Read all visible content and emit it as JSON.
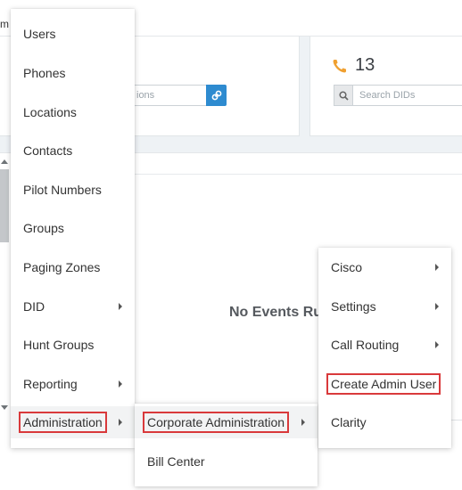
{
  "background": {
    "top_fragment": "m",
    "contacts_search_placeholder": "ions",
    "did_count": "13",
    "did_search_placeholder": "Search DIDs",
    "events_empty_text": "No Events Ru"
  },
  "main_menu": {
    "items": [
      {
        "label": "Users",
        "has_submenu": false
      },
      {
        "label": "Phones",
        "has_submenu": false
      },
      {
        "label": "Locations",
        "has_submenu": false
      },
      {
        "label": "Contacts",
        "has_submenu": false
      },
      {
        "label": "Pilot Numbers",
        "has_submenu": false
      },
      {
        "label": "Groups",
        "has_submenu": false
      },
      {
        "label": "Paging Zones",
        "has_submenu": false
      },
      {
        "label": "DID",
        "has_submenu": true
      },
      {
        "label": "Hunt Groups",
        "has_submenu": false
      },
      {
        "label": "Reporting",
        "has_submenu": true
      },
      {
        "label": "Administration",
        "has_submenu": true,
        "highlighted": true
      }
    ]
  },
  "administration_menu": {
    "items": [
      {
        "label": "Corporate Administration",
        "has_submenu": true,
        "highlighted": true
      },
      {
        "label": "Bill Center",
        "has_submenu": false
      }
    ]
  },
  "corporate_admin_menu": {
    "items": [
      {
        "label": "Cisco",
        "has_submenu": true
      },
      {
        "label": "Settings",
        "has_submenu": true
      },
      {
        "label": "Call Routing",
        "has_submenu": true
      },
      {
        "label": "Create Admin User",
        "has_submenu": false,
        "highlighted": true
      },
      {
        "label": "Clarity",
        "has_submenu": false
      }
    ]
  },
  "colors": {
    "highlight_border": "#d9393b",
    "accent_blue": "#2e8bd0",
    "phone_icon": "#f0a030"
  },
  "icons": [
    "link-icon",
    "phone-icon",
    "search-icon",
    "submenu-arrow-icon"
  ]
}
